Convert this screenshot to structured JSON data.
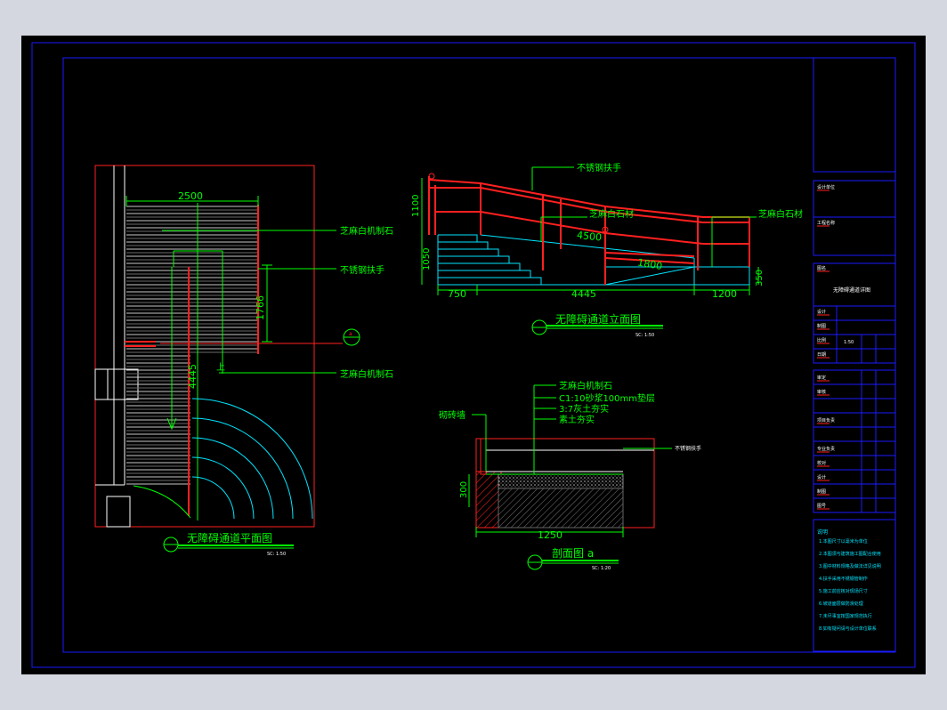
{
  "colors": {
    "background": "#000000",
    "frame": "#1a1aff",
    "red": "#ff2020",
    "green": "#00ff00",
    "cyan": "#00e5ff",
    "white": "#ffffff",
    "magenta": "#ff40ff",
    "pink": "#ff6080"
  },
  "plan_view": {
    "title": "无障碍通道平面图",
    "scale": "SC: 1:50",
    "dim_width": "2500",
    "dim_ramp": "1766",
    "dim_length": "4445",
    "label_1": "芝麻白机制石",
    "label_2": "不锈钢扶手",
    "label_3": "芝麻白机制石",
    "up_mark": "上",
    "section_marker": "a"
  },
  "elevation_view": {
    "title": "无障碍通道立面图",
    "scale": "SC: 1:50",
    "label_handrail": "不锈钢扶手",
    "label_stone_1": "芝麻白石材",
    "label_stone_2": "芝麻白石材",
    "dim_1100": "1100",
    "dim_1050": "1050",
    "dim_4500": "4500",
    "dim_1800": "1800",
    "dim_750": "750",
    "dim_4445": "4445",
    "dim_1200": "1200",
    "dim_350": "350"
  },
  "section_view": {
    "title": "剖面图 a",
    "scale": "SC: 1:20",
    "label_layer_1": "芝麻白机制石",
    "label_layer_2": "C1:10砂浆100mm垫层",
    "label_layer_3": "3:7灰土夯实",
    "label_layer_4": "素土夯实",
    "label_brick": "砌砖墙",
    "label_handrail": "不锈钢扶手",
    "dim_300": "300",
    "dim_1250": "1250"
  },
  "title_block": {
    "row_labels": [
      "设计单位",
      "工程名称",
      "图名",
      "设计",
      "制图",
      "比例",
      "日期",
      "审定",
      "审核",
      "项目负责",
      "专业负责",
      "校对",
      "设计",
      "制图",
      "图号"
    ],
    "drawing_name": "无障碍通道详图",
    "scale_value": "1:50",
    "notes_title": "说明",
    "notes": [
      "1.本图尺寸以毫米为单位",
      "2.本图须与建筑施工图配合使用",
      "3.图中材料规格及做法详见说明",
      "4.扶手采用不锈钢管制作",
      "5.施工前应核对现场尺寸",
      "6.坡道面层做防滑处理",
      "7.未尽事宜按国家规范执行",
      "8.如有疑问请与设计单位联系"
    ]
  }
}
